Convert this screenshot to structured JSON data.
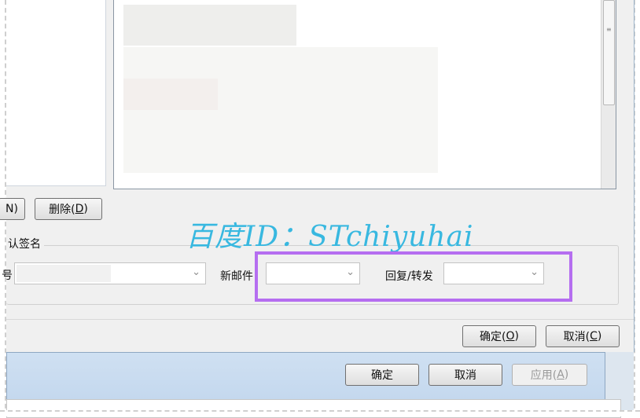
{
  "dialog": {
    "buttons": {
      "partial_left": "N)",
      "delete": "删除(",
      "delete_key": "D",
      "ok": "确定(",
      "ok_key": "O",
      "cancel": "取消(",
      "cancel_key": "C"
    },
    "group": {
      "title": "认签名",
      "field_left_label": "号",
      "new_mail_label": "新邮件",
      "reply_label": "回复/转发"
    }
  },
  "outer_window": {
    "ok": "确定",
    "cancel": "取消",
    "apply": "应用(",
    "apply_key": "A"
  },
  "watermark": "百度ID：STchiyuhai",
  "colors": {
    "highlight_border": "#b56ef0",
    "watermark": "#38b8e0",
    "outer_bar": "#cfe0f2"
  }
}
